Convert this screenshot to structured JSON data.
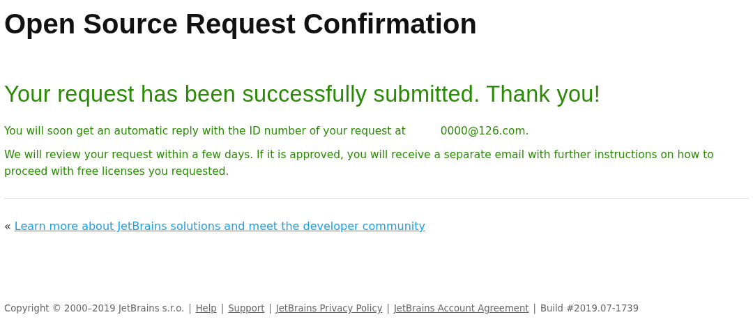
{
  "title": "Open Source Request Confirmation",
  "success_heading": "Your request has been successfully submitted. Thank you!",
  "messages": [
    {
      "text": "You will soon get an automatic reply with the ID number of your request at",
      "email": "0000@126.com."
    },
    {
      "text": "We will review your request within a few days. If it is approved, you will receive a separate email with further instructions on how to proceed with free licenses you requested."
    }
  ],
  "back_link": {
    "marker": "«",
    "label": "Learn more about JetBrains solutions and meet the developer community"
  },
  "footer": [
    {
      "kind": "text",
      "text": "Copyright © 2000–2019 JetBrains s.r.o."
    },
    {
      "kind": "separator",
      "text": "|"
    },
    {
      "kind": "link",
      "text": "Help"
    },
    {
      "kind": "separator",
      "text": "|"
    },
    {
      "kind": "link",
      "text": "Support"
    },
    {
      "kind": "separator",
      "text": "|"
    },
    {
      "kind": "link",
      "text": "JetBrains Privacy Policy"
    },
    {
      "kind": "separator",
      "text": "|"
    },
    {
      "kind": "link",
      "text": "JetBrains Account Agreement"
    },
    {
      "kind": "separator",
      "text": "|"
    },
    {
      "kind": "text",
      "text": "Build #2019.07-1739"
    }
  ]
}
